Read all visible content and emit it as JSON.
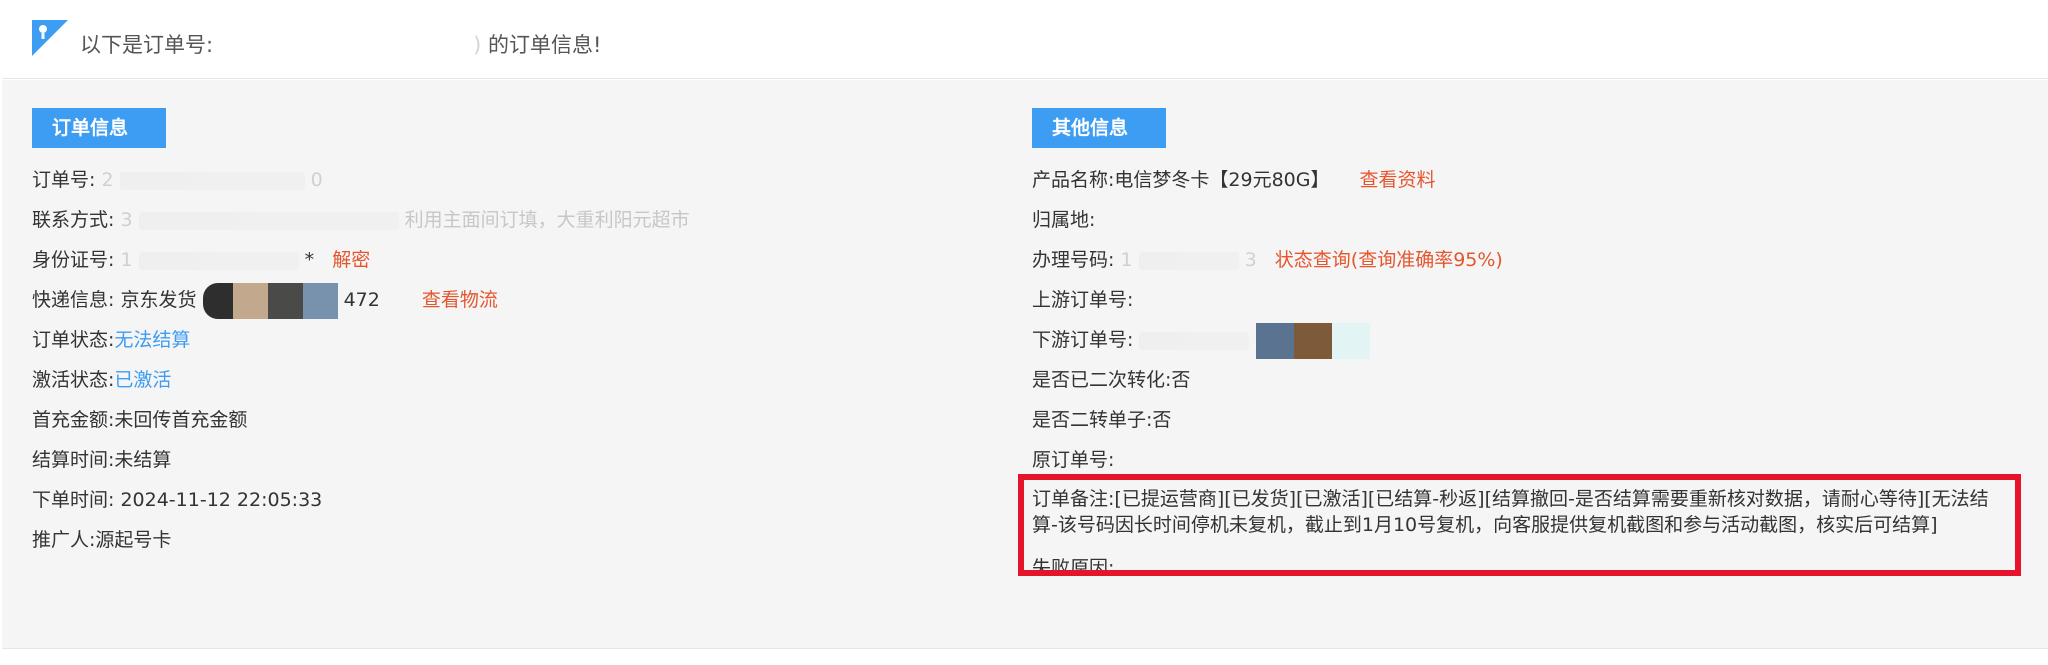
{
  "header": {
    "prefix": "以下是订单号:",
    "suffix": "的订单信息!",
    "order_number_masked": "",
    "order_number_tail": ")"
  },
  "left": {
    "section_title": "订单信息",
    "order_no": {
      "label": "订单号:",
      "prefix": "2",
      "tail": "0"
    },
    "contact": {
      "label": "联系方式:",
      "prefix": "3",
      "visible_fragment": "利用主面间订填，大重利阳元超市"
    },
    "id_card": {
      "label": "身份证号:",
      "prefix": "1",
      "tail": "*",
      "action": "解密"
    },
    "express": {
      "label": "快递信息:",
      "carrier": "京东发货",
      "tail": "472",
      "action": "查看物流"
    },
    "order_status": {
      "label": "订单状态:",
      "value": "无法结算"
    },
    "activation_status": {
      "label": "激活状态:",
      "value": "已激活"
    },
    "first_recharge": {
      "label": "首充金额:",
      "value": "未回传首充金额"
    },
    "settle_time": {
      "label": "结算时间:",
      "value": "未结算"
    },
    "order_time": {
      "label": "下单时间:",
      "value": "2024-11-12 22:05:33"
    },
    "promoter": {
      "label": "推广人:",
      "value": "源起号卡"
    }
  },
  "right": {
    "section_title": "其他信息",
    "product": {
      "label": "产品名称:",
      "value": "电信梦冬卡【29元80G】",
      "action": "查看资料"
    },
    "region": {
      "label": "归属地:",
      "value": ""
    },
    "phone": {
      "label": "办理号码:",
      "prefix": "1",
      "tail": "3",
      "action": "状态查询(查询准确率95%)"
    },
    "upstream": {
      "label": "上游订单号:",
      "value": ""
    },
    "downstream": {
      "label": "下游订单号:",
      "prefix": ""
    },
    "second_convert": {
      "label": "是否已二次转化:",
      "value": "否"
    },
    "second_transfer": {
      "label": "是否二转单子:",
      "value": "否"
    },
    "original_order": {
      "label": "原订单号:",
      "value": ""
    },
    "remark": {
      "label": "订单备注:",
      "value": "[已提运营商][已发货][已激活][已结算-秒返][结算撤回-是否结算需要重新核对数据，请耐心等待][无法结算-该号码因长时间停机未复机，截止到1月10号复机，向客服提供复机截图和参与活动截图，核实后可结算]"
    },
    "fail_reason": {
      "label": "失败原因:",
      "value": ""
    }
  },
  "colors": {
    "accent_blue": "#3d9df2",
    "link_orange": "#e4572e",
    "highlight_red": "#e5132b",
    "panel_bg": "#f5f5f5"
  }
}
